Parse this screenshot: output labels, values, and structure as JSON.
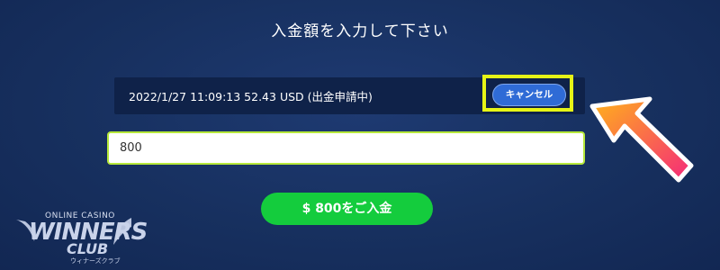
{
  "title": "入金額を入力して下さい",
  "pending": {
    "text": "2022/1/27 11:09:13 52.43 USD (出金申請中)",
    "cancel_label": "キャンセル"
  },
  "amount_input": {
    "value": "800"
  },
  "deposit_button": {
    "label": "$ 800をご入金"
  },
  "logo": {
    "line1": "ONLINE CASINO",
    "line2": "WINNERS",
    "line3": "CLUB",
    "line4": "ウィナーズクラブ"
  },
  "colors": {
    "background": "#17305f",
    "highlight": "#e6f416",
    "cancel": "#2f6bd6",
    "deposit": "#14cc3d",
    "arrow_start": "#ffb21a",
    "arrow_end": "#f5297a"
  }
}
